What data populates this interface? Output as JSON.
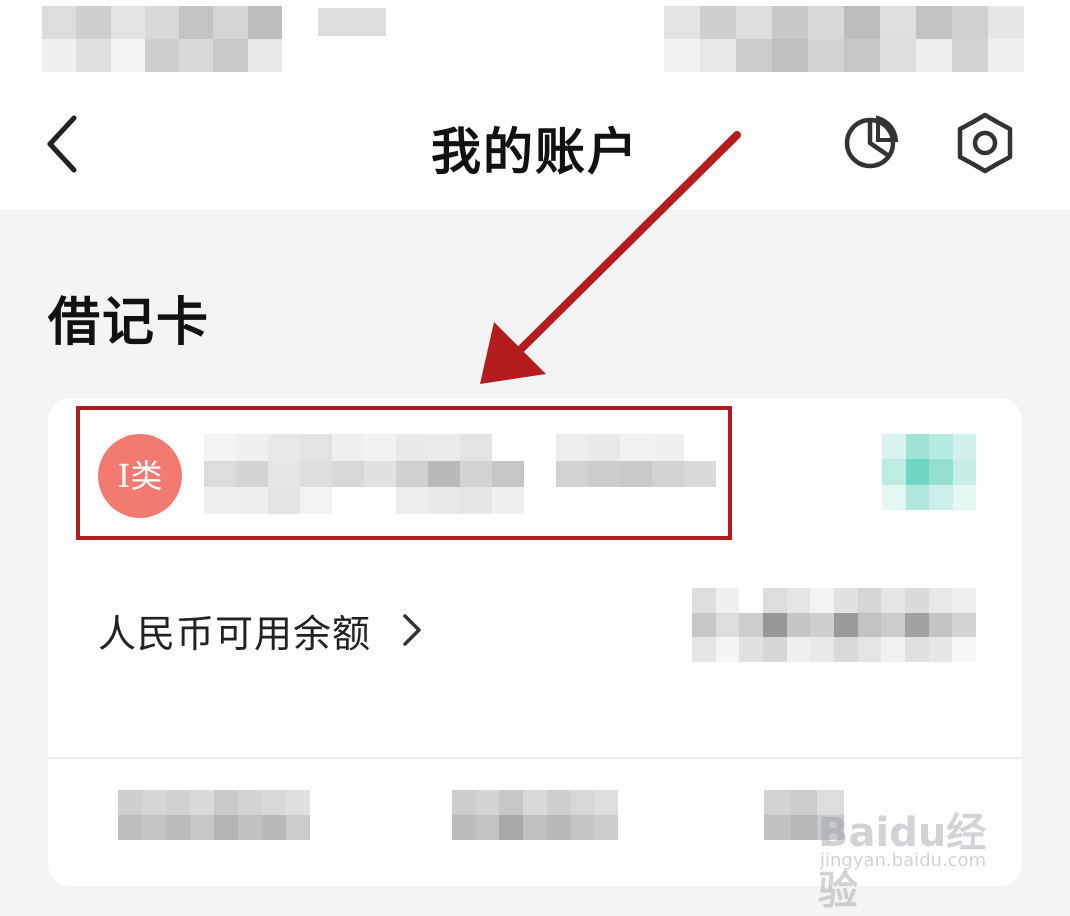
{
  "header": {
    "title": "我的账户",
    "back_icon": "chevron-left-icon",
    "stats_icon": "pie-chart-icon",
    "settings_icon": "gear-icon"
  },
  "section": {
    "title": "借记卡"
  },
  "card": {
    "badge_label": "I类",
    "balance_label": "人民币可用余额",
    "balance_chevron": "chevron-right-icon"
  },
  "annotation": {
    "highlight_color": "#b41c1e",
    "arrow_color": "#b41c1e"
  },
  "watermark": {
    "brand": "Baidu经验",
    "url": "jingyan.baidu.com"
  },
  "colors": {
    "badge_bg": "#f37a70",
    "page_bg": "#f4f4f4"
  }
}
